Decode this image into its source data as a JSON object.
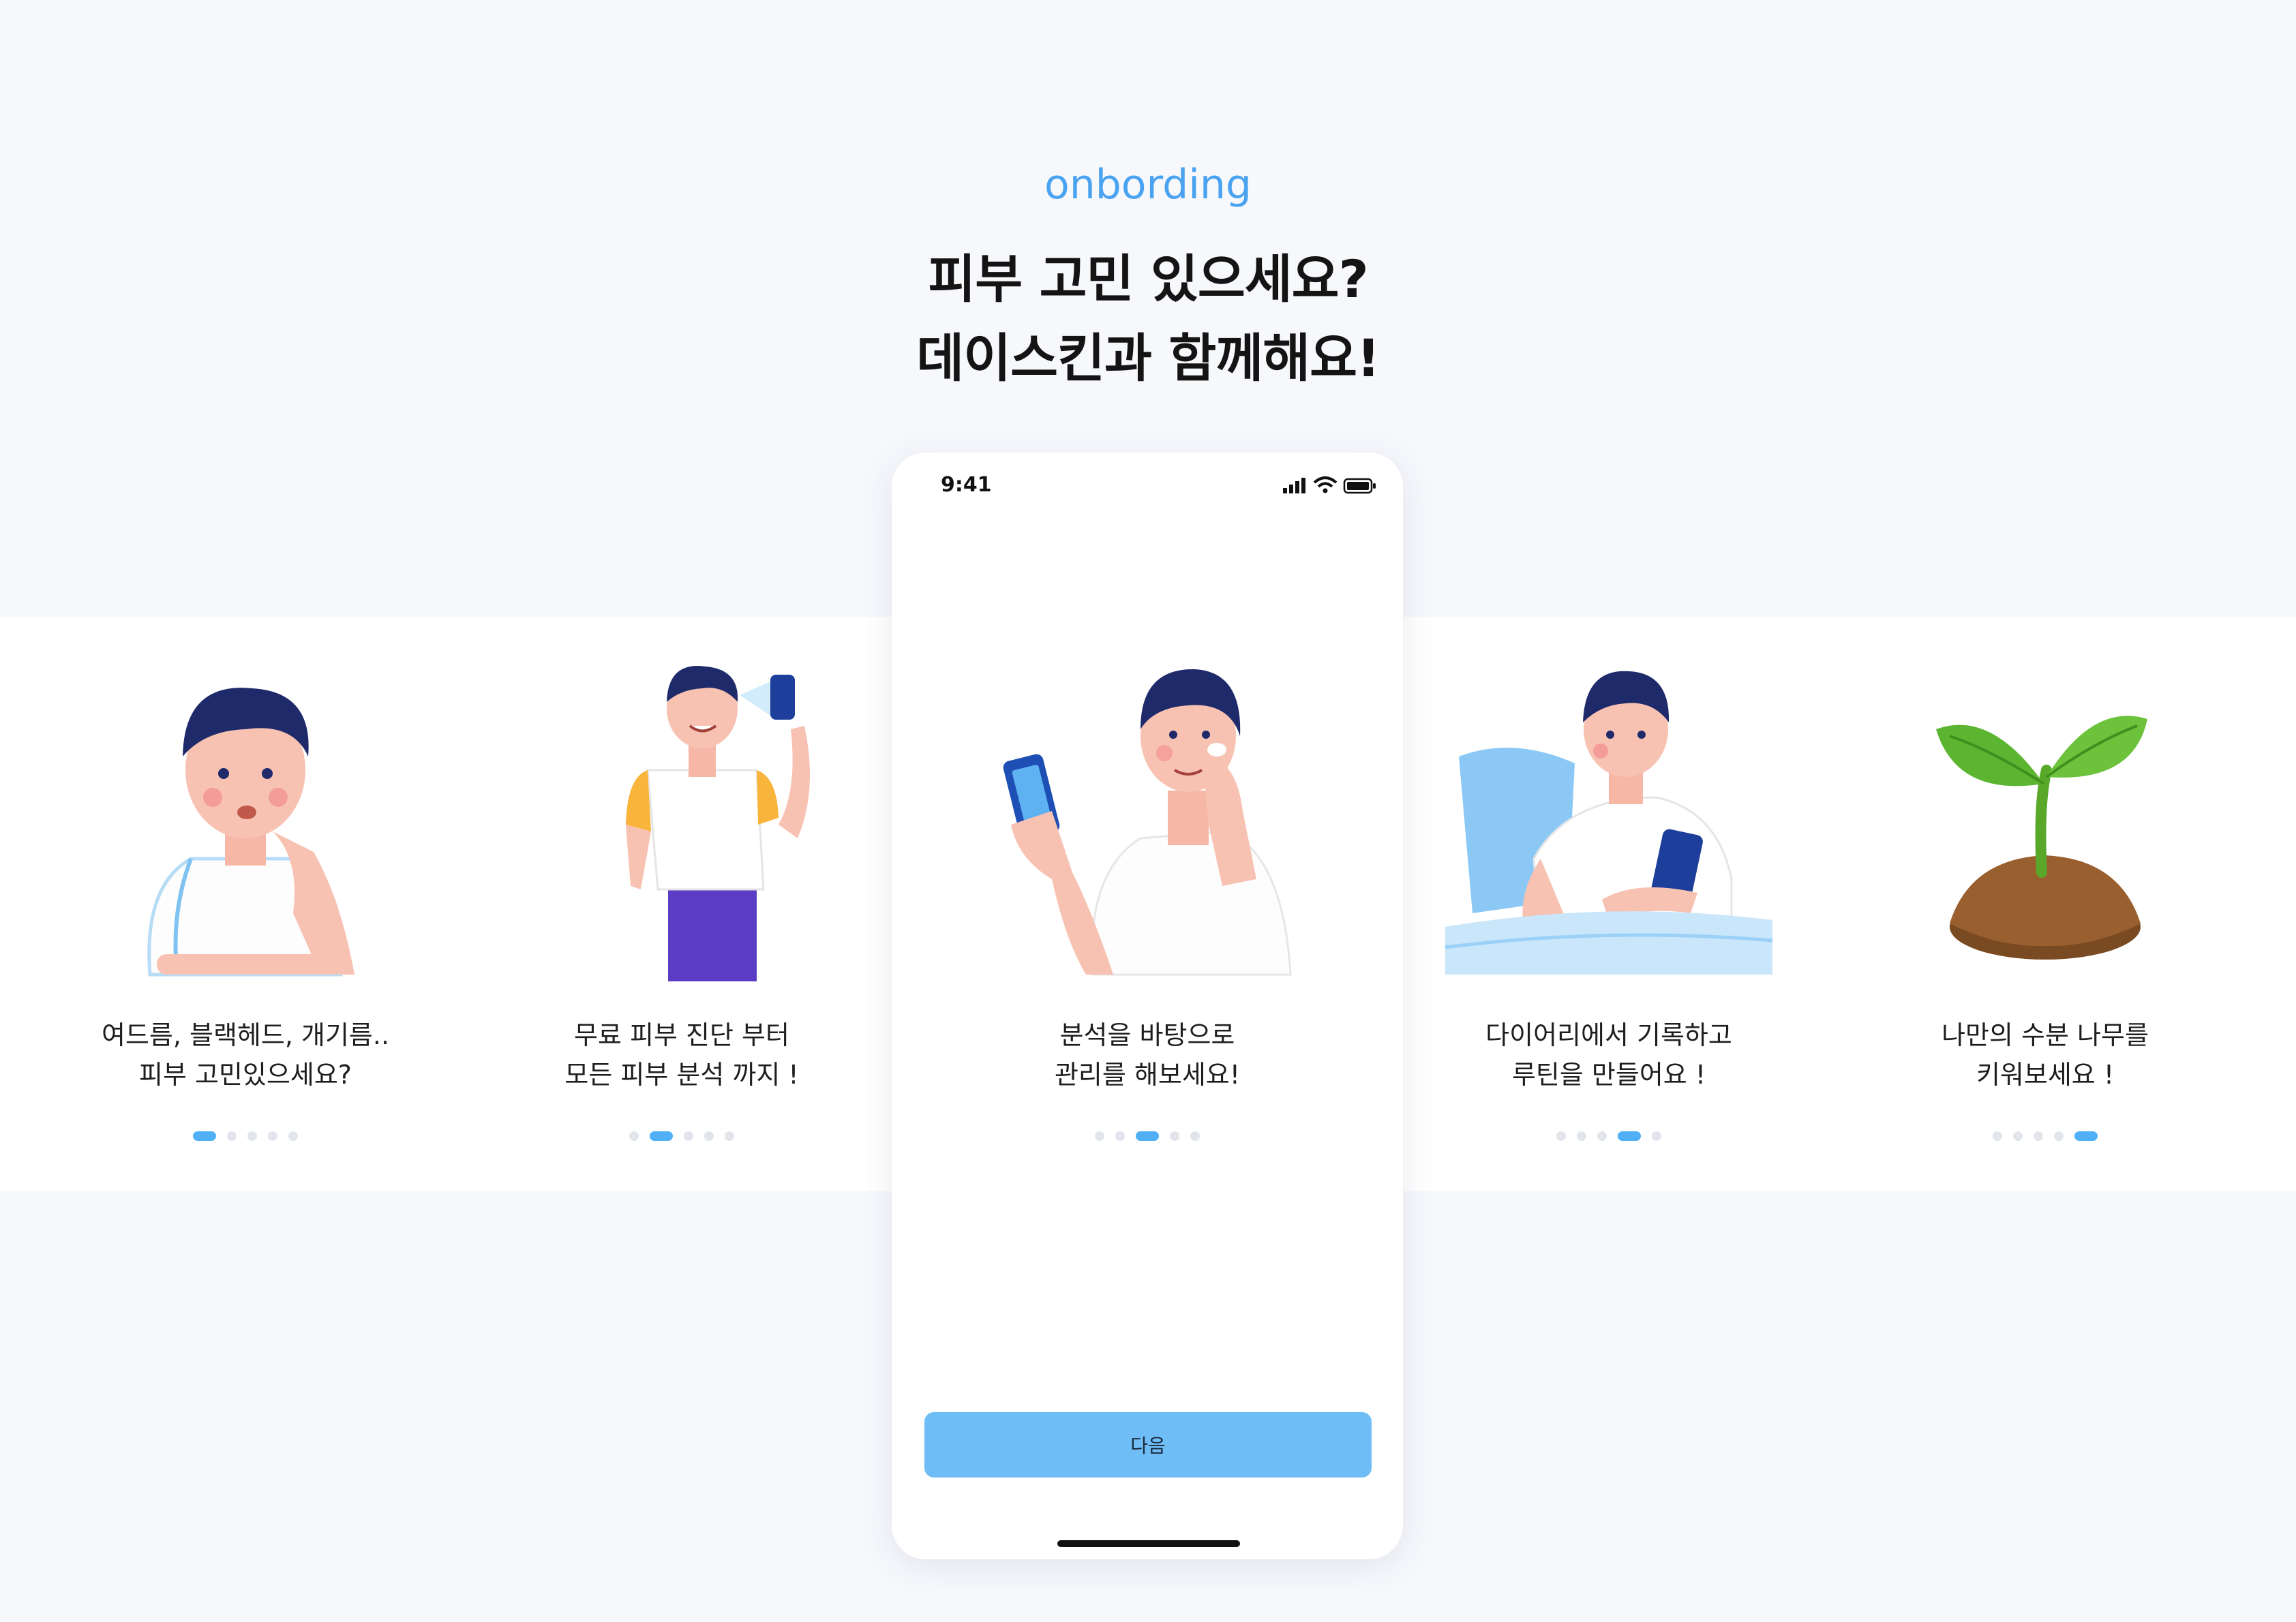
{
  "header": {
    "eyebrow": "onbording",
    "title_line1": "피부 고민 있으세요?",
    "title_line2": "데이스킨과 함께해요!"
  },
  "phone": {
    "time": "9:41",
    "status_icons": [
      "signal-icon",
      "wifi-icon",
      "battery-icon"
    ],
    "next_button": "다음"
  },
  "slides": [
    {
      "illustration": "worried-man-illustration",
      "line1": "여드름, 블랙헤드, 개기름..",
      "line2": "피부 고민있으세요?",
      "active_dot": 1
    },
    {
      "illustration": "selfie-man-illustration",
      "line1": "무료 피부 진단 부터",
      "line2": "모든 피부 분석 까지 !",
      "active_dot": 2
    },
    {
      "illustration": "skincare-man-illustration",
      "line1": "분석을 바탕으로",
      "line2": "관리를 해보세요!",
      "active_dot": 3
    },
    {
      "illustration": "bed-man-illustration",
      "line1": "다이어리에서 기록하고",
      "line2": "루틴을 만들어요 !",
      "active_dot": 4
    },
    {
      "illustration": "sprout-illustration",
      "line1": "나만의 수분 나무를",
      "line2": "키워보세요 !",
      "active_dot": 5
    }
  ],
  "dot_count": 5,
  "colors": {
    "accent": "#4aa3f0",
    "button": "#6fbdf7",
    "active_dot": "#4fb0f5",
    "inactive_dot": "#e2e5ec",
    "background": "#f7f8fc"
  }
}
